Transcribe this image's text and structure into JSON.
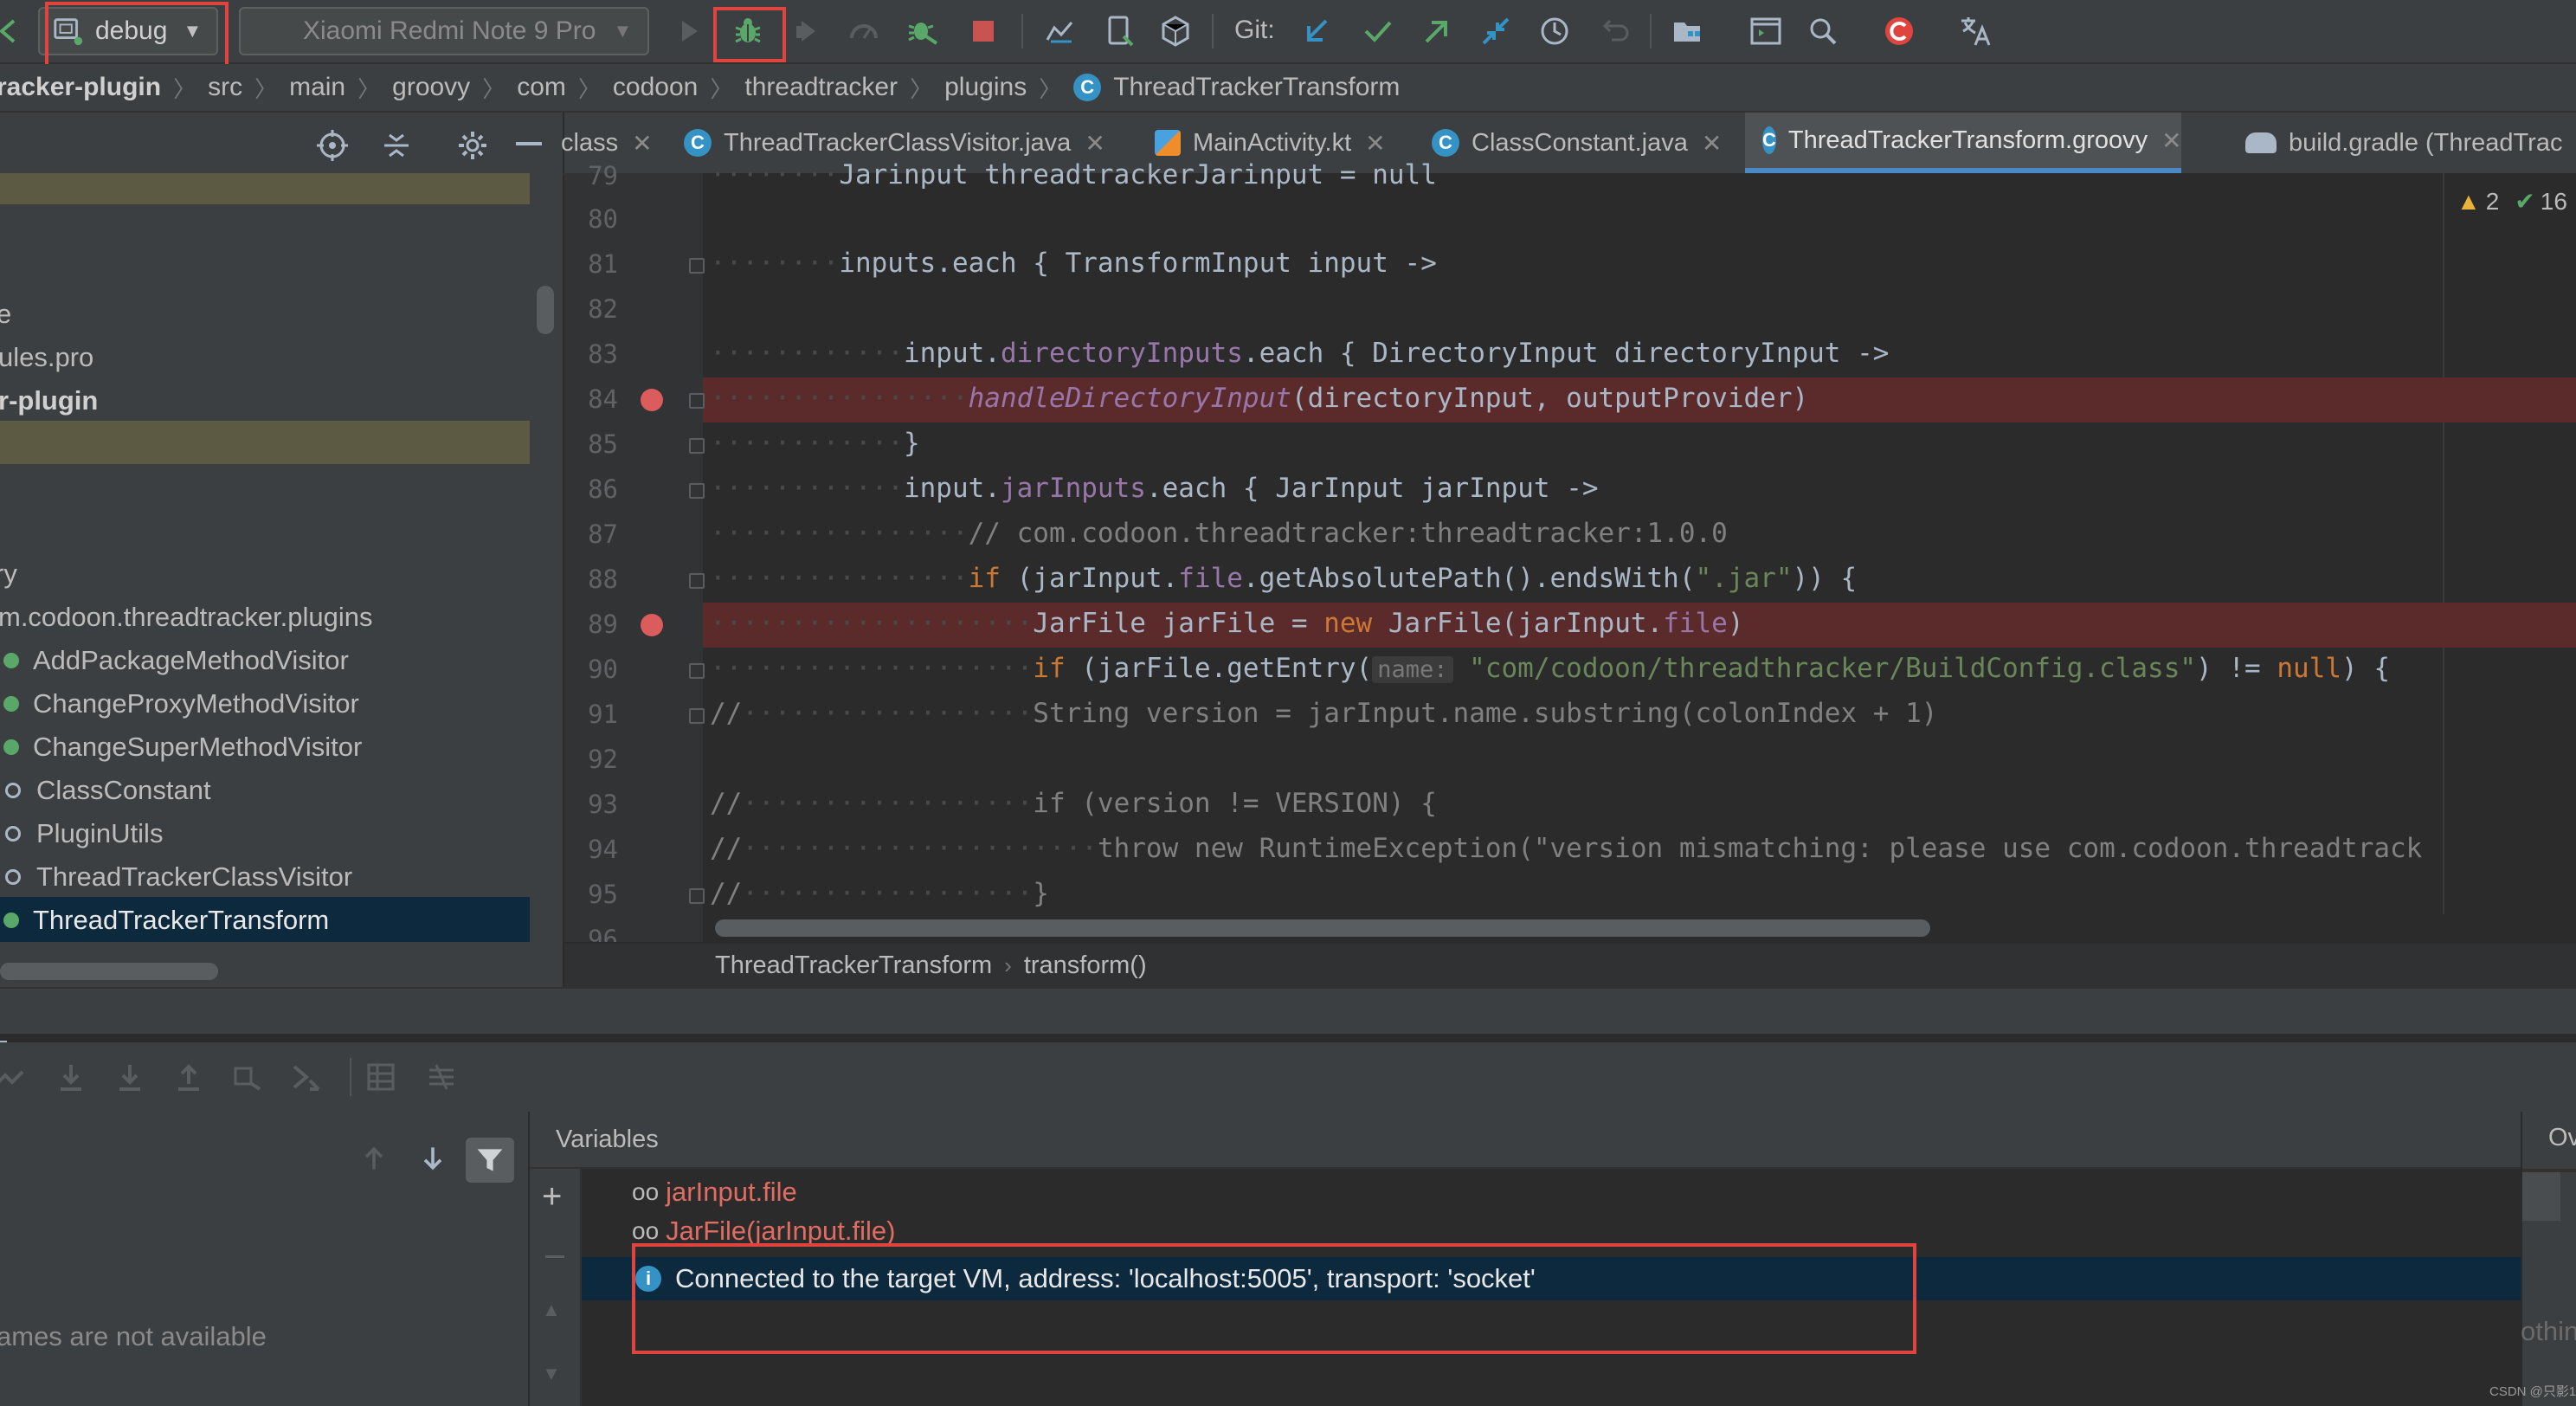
{
  "toolbar": {
    "run_config": "debug",
    "device": "Xiaomi Redmi Note 9 Pro",
    "git_label": "Git:"
  },
  "breadcrumbs": [
    "racker-plugin",
    "src",
    "main",
    "groovy",
    "com",
    "codoon",
    "threadtracker",
    "plugins",
    "ThreadTrackerTransform"
  ],
  "tabs": [
    {
      "label": "class",
      "icon": "none"
    },
    {
      "label": "ThreadTrackerClassVisitor.java",
      "icon": "c-class-icon"
    },
    {
      "label": "MainActivity.kt",
      "icon": "kotlin-file-icon"
    },
    {
      "label": "ClassConstant.java",
      "icon": "c-class-icon"
    },
    {
      "label": "ThreadTrackerTransform.groovy",
      "icon": "c-class-icon",
      "active": true
    },
    {
      "label": "build.gradle (ThreadTrac",
      "icon": "gradle-icon"
    }
  ],
  "project_tree": [
    {
      "label": "e"
    },
    {
      "label": "ules.pro"
    },
    {
      "label": "r-plugin"
    },
    {
      "label": "ry"
    },
    {
      "label": "m.codoon.threadtracker.plugins"
    },
    {
      "label": "AddPackageMethodVisitor"
    },
    {
      "label": "ChangeProxyMethodVisitor"
    },
    {
      "label": "ChangeSuperMethodVisitor"
    },
    {
      "label": "ClassConstant"
    },
    {
      "label": "PluginUtils"
    },
    {
      "label": "ThreadTrackerClassVisitor"
    },
    {
      "label": "ThreadTrackerTransform"
    }
  ],
  "editor": {
    "line_numbers": [
      "79",
      "80",
      "81",
      "82",
      "83",
      "84",
      "85",
      "86",
      "87",
      "88",
      "89",
      "90",
      "91",
      "92",
      "93",
      "94",
      "95",
      "96"
    ],
    "inspection": {
      "warnings": "2",
      "ok": "16"
    },
    "hint_name": "name:",
    "code": {
      "l79": "Jarinput threadtrackerJarinput = null",
      "l81": "inputs.each { TransformInput input ->",
      "l83a": "input.",
      "l83b": "directoryInputs",
      "l83c": ".each { DirectoryInput directoryInput ->",
      "l84a": "handleDirectoryInput",
      "l84b": "(directoryInput, outputProvider)",
      "l85": "}",
      "l86a": "input.",
      "l86b": "jarInputs",
      "l86c": ".each { JarInput jarInput ->",
      "l87": "// com.codoon.threadtracker:threadtracker:1.0.0",
      "l88a": "if",
      "l88b": " (jarInput.",
      "l88c": "file",
      "l88d": ".getAbsolutePath().endsWith(",
      "l88e": "\".jar\"",
      "l88f": ")) {",
      "l89a": "JarFile jarFile = ",
      "l89b": "new",
      "l89c": " JarFile(jarInput.",
      "l89d": "file",
      "l89e": ")",
      "l90a": "if",
      "l90b": " (jarFile.getEntry(",
      "l90c": "\"com/codoon/threadthracker/BuildConfig.class\"",
      "l90d": ") != ",
      "l90e": "null",
      "l90f": ") {",
      "l91a": "//",
      "l91b": "String version = jarInput.name.substring(colonIndex + 1)",
      "l93a": "//",
      "l93b": "if (version != VERSION) {",
      "l94a": "//",
      "l94b": "throw new RuntimeException(\"version mismatching: please use com.codoon.threadtrack",
      "l95a": "//",
      "l95b": "}"
    },
    "breadcrumb": [
      "ThreadTrackerTransform",
      "transform()"
    ]
  },
  "debugger": {
    "frames_message": "ames are not available",
    "variables_title": "Variables",
    "overhead_title": "Ov",
    "overhead_text": "othin",
    "watches": [
      "jarInput.file",
      "JarFile(jarInput.file)"
    ],
    "connected_message": "Connected to the target VM, address: 'localhost:5005', transport: 'socket'"
  },
  "watermark": "CSDN @只影1"
}
